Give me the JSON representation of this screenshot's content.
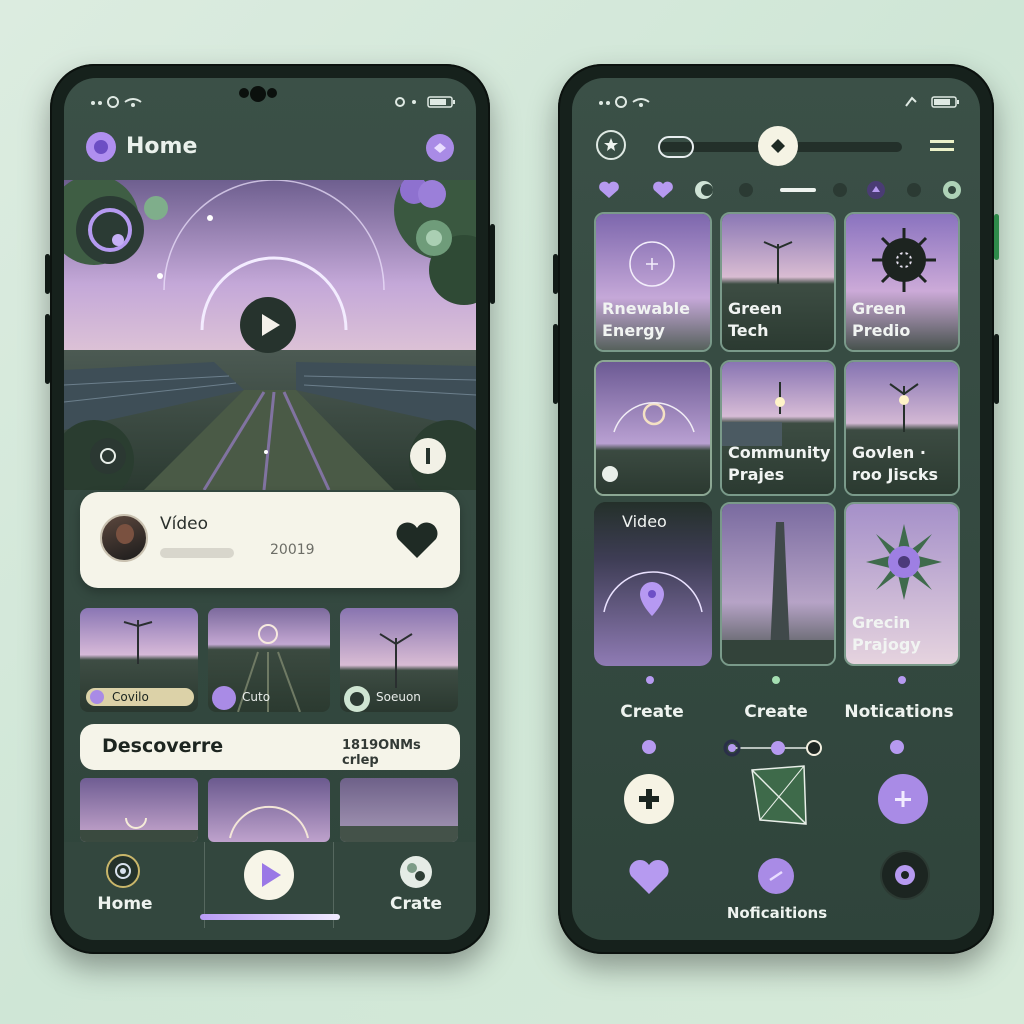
{
  "left_phone": {
    "status_icons": [
      "signal-icon",
      "wifi-icon",
      "battery-icon"
    ],
    "header": {
      "title": "Home"
    },
    "hero": {
      "play_icon": "play-icon"
    },
    "video_card": {
      "title": "Vídeo",
      "meta": "20019"
    },
    "thumbnails": [
      {
        "label": "Covilo"
      },
      {
        "label": "Cuto"
      },
      {
        "label": "Soeuon"
      }
    ],
    "discover": {
      "title": "Descoverre",
      "meta": "1819ONMs crlep"
    },
    "bottom_nav": {
      "home_label": "Home",
      "create_label": "Crate"
    }
  },
  "right_phone": {
    "tiles": [
      {
        "label": "Rnewable Energy"
      },
      {
        "label": "Green Tech"
      },
      {
        "label": "Green Predio"
      },
      {
        "label": ""
      },
      {
        "label": "Community Prajes"
      },
      {
        "label": "Govlen · roo Jiscks"
      },
      {
        "label": "Video"
      },
      {
        "label": ""
      },
      {
        "label": "Grecin Prajogy"
      }
    ],
    "actions": {
      "create1": "Create",
      "create2": "Create",
      "notifications": "Notications"
    },
    "bottom_label": "Noficaitions"
  },
  "colors": {
    "accent": "#a98be6",
    "bg": "#3b5047",
    "frame": "#16211c"
  }
}
